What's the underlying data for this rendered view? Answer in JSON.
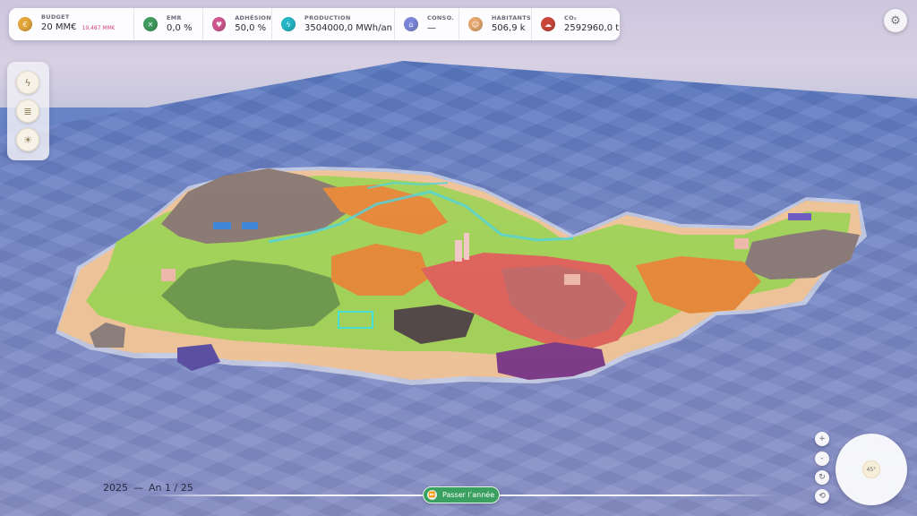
{
  "stats": [
    {
      "label": "BUDGET",
      "value": "20 MM€",
      "sub": "19,487 MM€",
      "color": "#e2a63a",
      "icon": "coin-icon"
    },
    {
      "label": "EMR",
      "value": "0,0 %",
      "color": "#3f9a5e",
      "icon": "emr-icon"
    },
    {
      "label": "ADHÉSION",
      "value": "50,0 %",
      "color": "#d0568f",
      "icon": "adhesion-icon"
    },
    {
      "label": "PRODUCTION",
      "value": "3504000,0 MWh/an",
      "color": "#25b6c6",
      "icon": "production-icon"
    },
    {
      "label": "CONSO.",
      "value": "—",
      "color": "#7c86d8",
      "icon": "consumption-icon"
    },
    {
      "label": "HABITANTS",
      "value": "506,9 k",
      "color": "#e3a76f",
      "icon": "population-icon"
    },
    {
      "label": "CO₂",
      "value": "2592960,0 t",
      "color": "#c8473a",
      "icon": "co2-icon"
    }
  ],
  "tools": [
    {
      "icon": "energy-tool-icon",
      "glyph": "ϟ"
    },
    {
      "icon": "layers-tool-icon",
      "glyph": "≣"
    },
    {
      "icon": "landscape-tool-icon",
      "glyph": "☀"
    }
  ],
  "settings": {
    "icon": "gear-icon",
    "glyph": "⚙"
  },
  "map_controls": {
    "zoom_in": "+",
    "zoom_out": "-",
    "rotate": "↻",
    "reset": "⟲"
  },
  "compass": {
    "angle_label": "45°"
  },
  "timeline": {
    "year": "2025",
    "separator": "—",
    "progress": "An 1 / 25",
    "next_button": "Passer l’année",
    "next_icon": "⏩"
  },
  "colors": {
    "grass": "#a4d45a",
    "forest": "#6f9a4e",
    "rock": "#8c7a74",
    "sand": "#f1c59a",
    "industry_red": "#c9696c",
    "orange_zone": "#e8893a",
    "water": "#5f7bc4",
    "accent_green": "#3aa060"
  }
}
